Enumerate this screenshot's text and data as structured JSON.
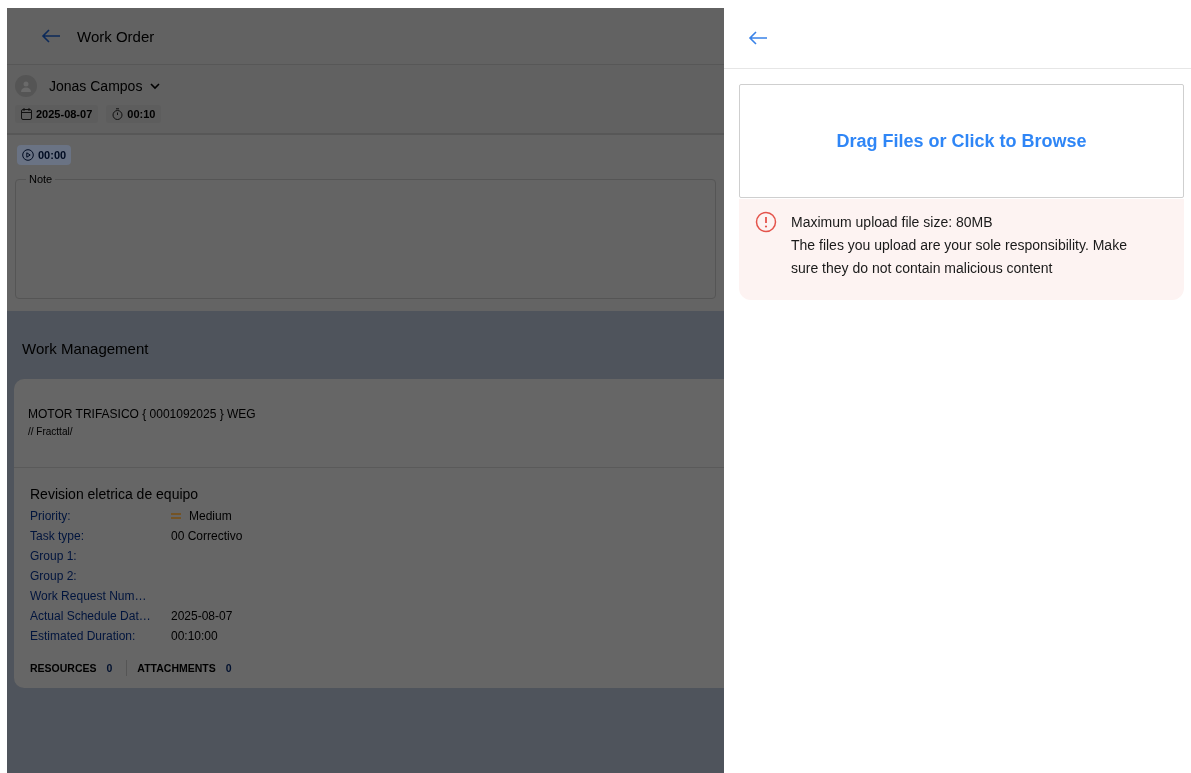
{
  "work_order": {
    "title": "Work Order",
    "user": "Jonas Campos",
    "date": "2025-08-07",
    "duration": "00:10",
    "timer": "00:00",
    "note": {
      "label": "Note"
    }
  },
  "work_management": {
    "title": "Work Management",
    "asset": {
      "name": "MOTOR TRIFASICO { 0001092025 } WEG",
      "path": "// Fracttal/"
    },
    "task": {
      "title": "Revision eletrica de equipo",
      "fields": [
        {
          "label": "Priority:",
          "value": "Medium",
          "kind": "priority"
        },
        {
          "label": "Task type:",
          "value": "00 Correctivo",
          "kind": "text"
        },
        {
          "label": "Group 1:",
          "kind": "text"
        },
        {
          "label": "Group 2:",
          "kind": "text"
        },
        {
          "label": "Work Request Num…",
          "kind": "text"
        },
        {
          "label": "Actual Schedule Dat…",
          "value": "2025-08-07",
          "kind": "text"
        },
        {
          "label": "Estimated Duration:",
          "value": "00:10:00",
          "kind": "text"
        }
      ],
      "counters": [
        {
          "label": "RESOURCES",
          "count": "0"
        },
        {
          "label": "ATTACHMENTS",
          "count": "0"
        }
      ]
    }
  },
  "upload_panel": {
    "dropzone": "Drag Files or Click to Browse",
    "notice": [
      "Maximum upload file size: 80MB",
      "The files you upload are your sole responsibility. Make sure they do not contain malicious content"
    ]
  }
}
